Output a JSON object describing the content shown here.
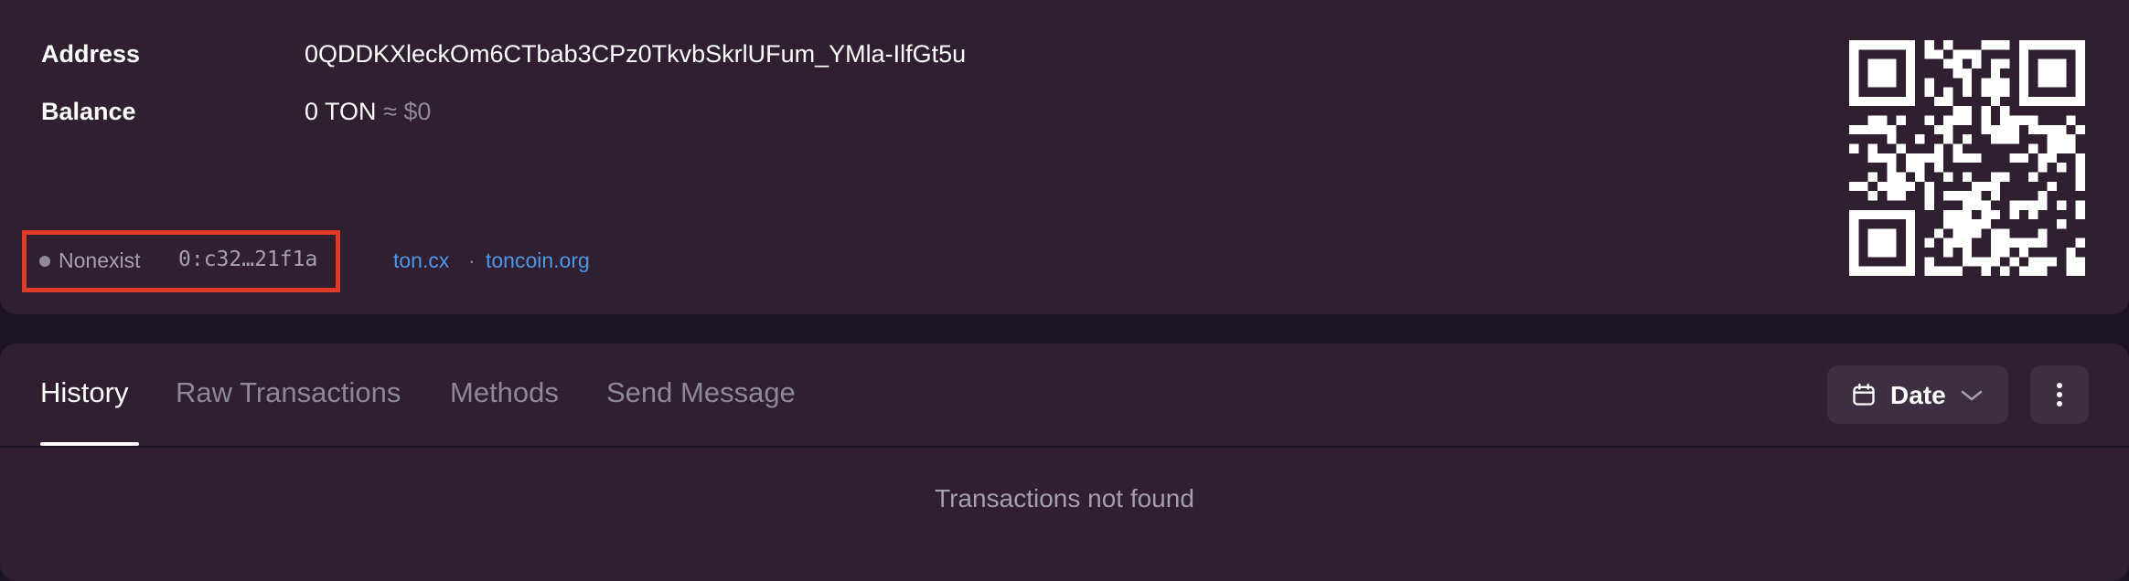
{
  "account": {
    "address_label": "Address",
    "address_value": "0QDDKXleckOm6CTbab3CPz0TkvbSkrlUFum_YMla-IlfGt5u",
    "balance_label": "Balance",
    "balance_value": "0 TON",
    "balance_fiat": "≈ $0",
    "status": "Nonexist",
    "raw_address_short": "0:c32…21f1a",
    "links": [
      {
        "label": "ton.cx"
      },
      {
        "label": "toncoin.org"
      }
    ],
    "link_separator": "·",
    "qr_icon": "qr-code"
  },
  "tabs": [
    {
      "label": "History",
      "active": true
    },
    {
      "label": "Raw Transactions",
      "active": false
    },
    {
      "label": "Methods",
      "active": false
    },
    {
      "label": "Send Message",
      "active": false
    }
  ],
  "filters": {
    "date_label": "Date",
    "date_icon": "calendar-icon",
    "more_icon": "more-vertical-icon"
  },
  "empty_state": "Transactions not found",
  "colors": {
    "background": "#1c1422",
    "card": "#2f1f31",
    "link": "#4d97e8",
    "highlight_border": "#e03b27"
  }
}
